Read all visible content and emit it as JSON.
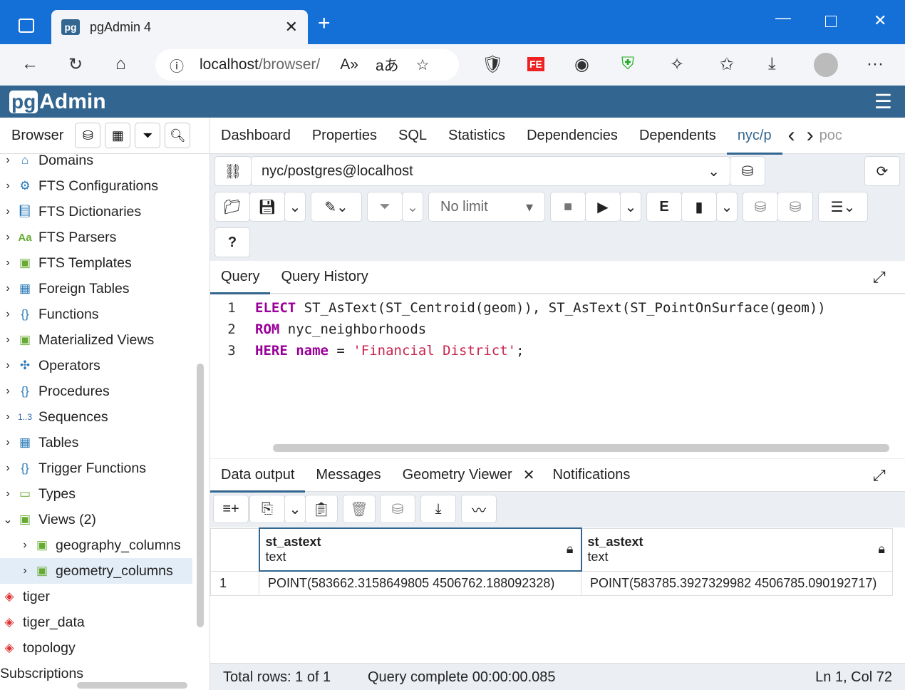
{
  "browser": {
    "tab_title": "pgAdmin 4",
    "url_host": "localhost",
    "url_path": "/browser/",
    "new_tab": "+"
  },
  "app": {
    "logo_pg": "pg",
    "logo_text": "Admin"
  },
  "left": {
    "title": "Browser",
    "tree": [
      {
        "label": "Domains",
        "icon": "domains-icon",
        "level": 0,
        "chev": "›"
      },
      {
        "label": "FTS Configurations",
        "icon": "fts-config-icon",
        "level": 0,
        "chev": "›"
      },
      {
        "label": "FTS Dictionaries",
        "icon": "fts-dict-icon",
        "level": 0,
        "chev": "›"
      },
      {
        "label": "FTS Parsers",
        "icon": "fts-parser-icon",
        "level": 0,
        "chev": "›"
      },
      {
        "label": "FTS Templates",
        "icon": "fts-template-icon",
        "level": 0,
        "chev": "›"
      },
      {
        "label": "Foreign Tables",
        "icon": "foreign-table-icon",
        "level": 0,
        "chev": "›"
      },
      {
        "label": "Functions",
        "icon": "function-icon",
        "level": 0,
        "chev": "›"
      },
      {
        "label": "Materialized Views",
        "icon": "mview-icon",
        "level": 0,
        "chev": "›"
      },
      {
        "label": "Operators",
        "icon": "operator-icon",
        "level": 0,
        "chev": "›"
      },
      {
        "label": "Procedures",
        "icon": "procedure-icon",
        "level": 0,
        "chev": "›"
      },
      {
        "label": "Sequences",
        "icon": "sequence-icon",
        "level": 0,
        "chev": "›"
      },
      {
        "label": "Tables",
        "icon": "table-icon",
        "level": 0,
        "chev": "›"
      },
      {
        "label": "Trigger Functions",
        "icon": "trigger-function-icon",
        "level": 0,
        "chev": "›"
      },
      {
        "label": "Types",
        "icon": "type-icon",
        "level": 0,
        "chev": "›"
      },
      {
        "label": "Views (2)",
        "icon": "view-icon",
        "level": 0,
        "chev": "⌄"
      },
      {
        "label": "geography_columns",
        "icon": "view-icon",
        "level": 1,
        "chev": "›"
      },
      {
        "label": "geometry_columns",
        "icon": "view-icon",
        "level": 1,
        "chev": "›"
      },
      {
        "label": "tiger",
        "icon": "schema-icon",
        "level": -1,
        "chev": ""
      },
      {
        "label": "tiger_data",
        "icon": "schema-icon",
        "level": -1,
        "chev": ""
      },
      {
        "label": "topology",
        "icon": "schema-icon",
        "level": -1,
        "chev": ""
      },
      {
        "label": "Subscriptions",
        "icon": "",
        "level": -1,
        "chev": ""
      }
    ]
  },
  "tabs": [
    "Dashboard",
    "Properties",
    "SQL",
    "Statistics",
    "Dependencies",
    "Dependents",
    "nyc/p"
  ],
  "tab_overflow": "poc",
  "connection": "nyc/postgres@localhost",
  "limit": "No limit",
  "editor_tabs": [
    "Query",
    "Query History"
  ],
  "code": [
    {
      "n": "1",
      "kw": "ELECT",
      "rest": " ST_AsText(ST_Centroid(geom)), ST_AsText(ST_PointOnSurface(geom))"
    },
    {
      "n": "2",
      "kw": "ROM",
      "rest": " nyc_neighborhoods"
    },
    {
      "n": "3",
      "kw": "HERE",
      "kw2": "name",
      "op": " = ",
      "str": "'Financial District'",
      "end": ";"
    }
  ],
  "output_tabs": [
    "Data output",
    "Messages",
    "Geometry Viewer",
    "Notifications"
  ],
  "columns": [
    {
      "name": "st_astext",
      "type": "text"
    },
    {
      "name": "st_astext",
      "type": "text"
    }
  ],
  "rows": [
    {
      "n": "1",
      "cells": [
        "POINT(583662.3158649805 4506762.188092328)",
        "POINT(583785.3927329982 4506785.090192717)"
      ]
    }
  ],
  "status": {
    "rows": "Total rows: 1 of 1",
    "query": "Query complete 00:00:00.085",
    "pos": "Ln 1, Col 72"
  },
  "colors": {
    "accent": "#326690",
    "browser": "#1470d6"
  }
}
